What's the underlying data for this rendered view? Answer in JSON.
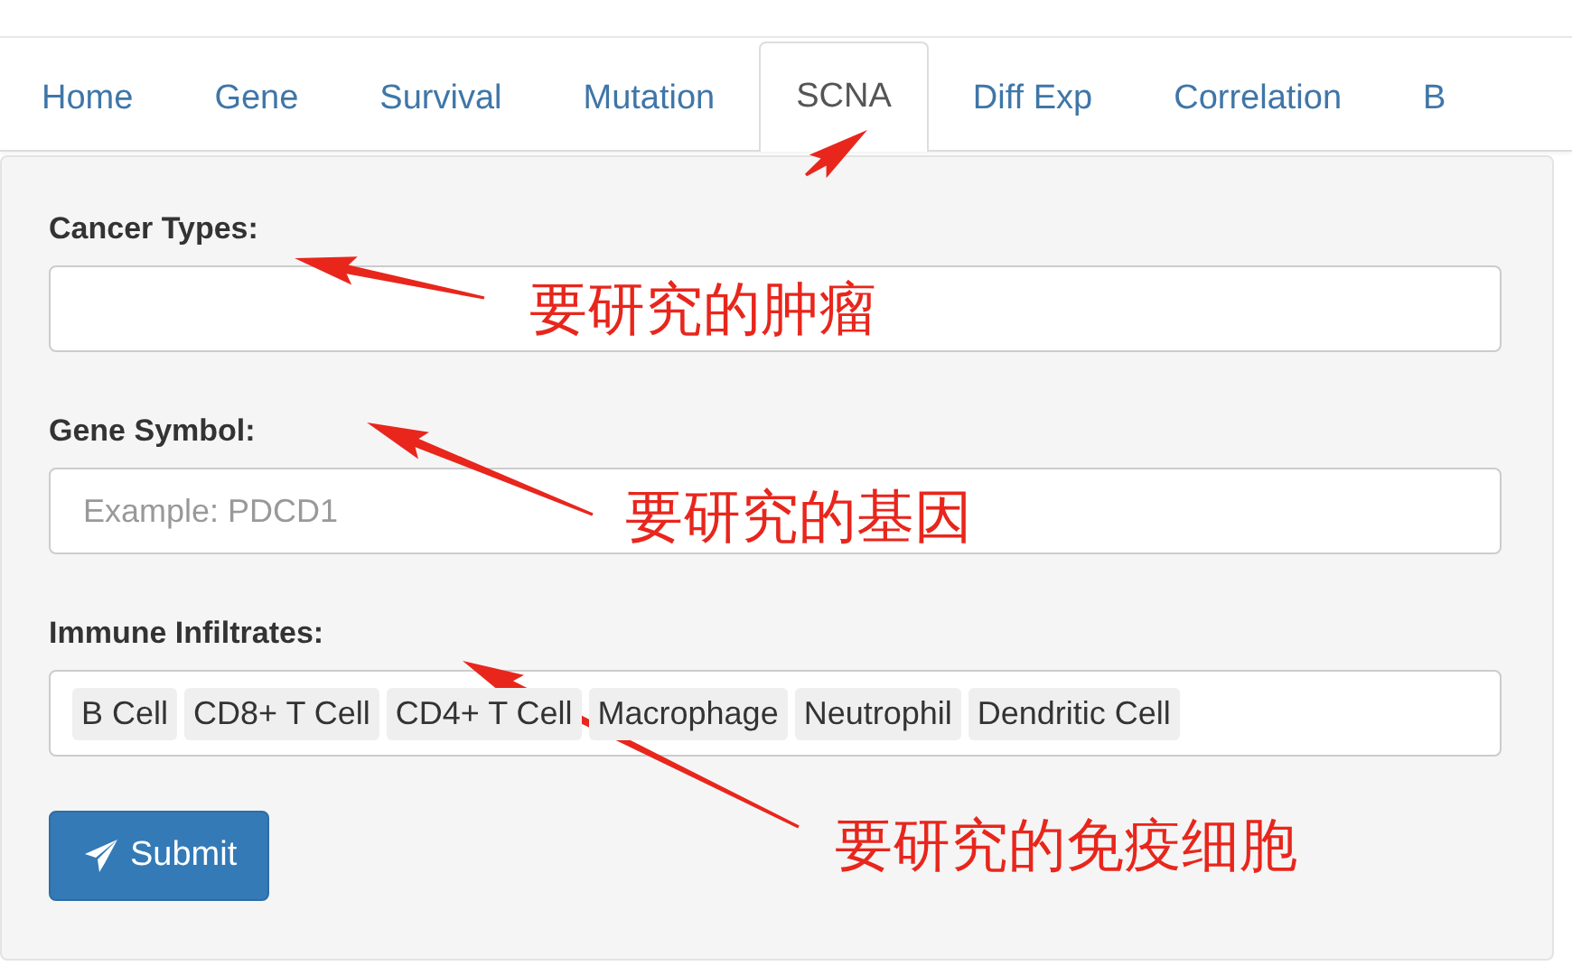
{
  "tabs": [
    {
      "label": "Home",
      "selected": false
    },
    {
      "label": "Gene",
      "selected": false
    },
    {
      "label": "Survival",
      "selected": false
    },
    {
      "label": "Mutation",
      "selected": false
    },
    {
      "label": "SCNA",
      "selected": true
    },
    {
      "label": "Diff Exp",
      "selected": false
    },
    {
      "label": "Correlation",
      "selected": false
    },
    {
      "label": "B",
      "selected": false
    }
  ],
  "form": {
    "fields": [
      {
        "label": "Cancer Types:",
        "kind": "text"
      },
      {
        "label": "Gene Symbol:",
        "kind": "text",
        "placeholder": "Example: PDCD1"
      },
      {
        "label": "Immune Infiltrates:",
        "kind": "tags",
        "tags": [
          "B Cell",
          "CD8+ T Cell",
          "CD4+ T Cell",
          "Macrophage",
          "Neutrophil",
          "Dendritic Cell"
        ]
      }
    ],
    "submit": "Submit"
  },
  "annotations": [
    "要研究的肿瘤",
    "要研究的基因",
    "要研究的免疫细胞"
  ]
}
